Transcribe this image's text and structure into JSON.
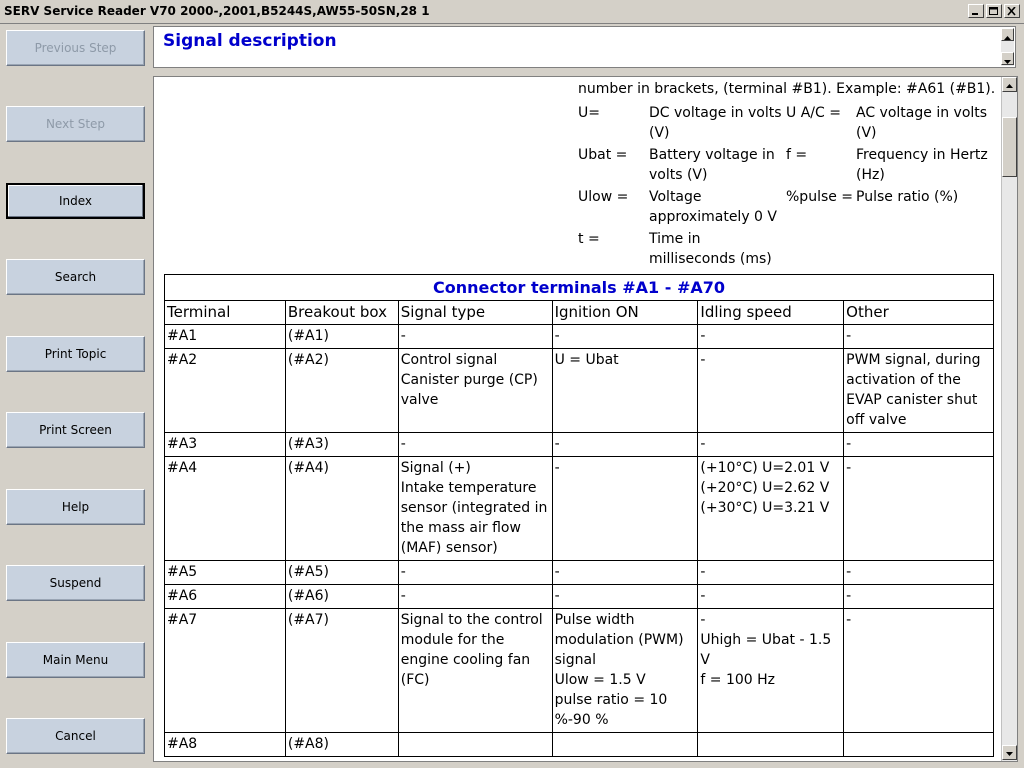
{
  "window": {
    "title": "SERV Service Reader V70 2000-,2001,B5244S,AW55-50SN,28 1"
  },
  "sidebar": {
    "buttons": [
      {
        "label": "Previous Step"
      },
      {
        "label": "Next Step"
      },
      {
        "label": "Index"
      },
      {
        "label": "Search"
      },
      {
        "label": "Print Topic"
      },
      {
        "label": "Print Screen"
      },
      {
        "label": "Help"
      },
      {
        "label": "Suspend"
      },
      {
        "label": "Main Menu"
      },
      {
        "label": "Cancel"
      }
    ]
  },
  "header": {
    "title": "Signal description"
  },
  "legend": {
    "intro": "number in brackets, (terminal #B1). Example: #A61 (#B1).",
    "rows": [
      {
        "k1": "U=",
        "v1": "DC voltage in volts (V)",
        "k2": "U A/C =",
        "v2": "AC voltage in volts (V)"
      },
      {
        "k1": "Ubat =",
        "v1": "Battery voltage in volts (V)",
        "k2": "f =",
        "v2": "Frequency in Hertz (Hz)"
      },
      {
        "k1": "Ulow =",
        "v1": "Voltage approximately 0 V",
        "k2": "%pulse =",
        "v2": "Pulse ratio (%)"
      },
      {
        "k1": "t =",
        "v1": "Time in milliseconds (ms)",
        "k2": "",
        "v2": ""
      }
    ]
  },
  "table": {
    "caption": "Connector terminals #A1 - #A70",
    "headers": [
      "Terminal",
      "Breakout box",
      "Signal type",
      "Ignition ON",
      "Idling speed",
      "Other"
    ],
    "rows": [
      [
        "#A1",
        "(#A1)",
        "-",
        "-",
        "-",
        "-"
      ],
      [
        "#A2",
        "(#A2)",
        "Control signal Canister purge (CP) valve",
        "U = Ubat",
        "-",
        "PWM signal, during activation of the EVAP canister shut off valve"
      ],
      [
        "#A3",
        "(#A3)",
        "-",
        "-",
        "-",
        "-"
      ],
      [
        "#A4",
        "(#A4)",
        "Signal (+)\nIntake temperature sensor (integrated in the mass air flow (MAF) sensor)",
        "-",
        "(+10°C) U=2.01 V\n(+20°C) U=2.62 V\n(+30°C) U=3.21 V",
        "-"
      ],
      [
        "#A5",
        "(#A5)",
        "-",
        "-",
        "-",
        "-"
      ],
      [
        "#A6",
        "(#A6)",
        "-",
        "-",
        "-",
        "-"
      ],
      [
        "#A7",
        "(#A7)",
        "Signal to the control module for the engine cooling fan (FC)",
        "Pulse width modulation (PWM) signal\nUlow = 1.5 V\npulse ratio = 10 %-90 %",
        "-\nUhigh = Ubat - 1.5 V\nf = 100 Hz",
        "-"
      ],
      [
        "#A8",
        "(#A8)",
        "",
        "",
        "",
        ""
      ]
    ]
  }
}
